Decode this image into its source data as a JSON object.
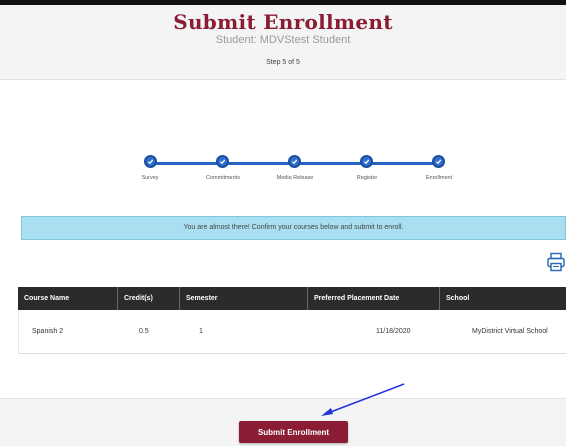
{
  "header": {
    "title": "Submit Enrollment",
    "student": "Student: MDVStest Student",
    "step": "Step 5 of 5"
  },
  "progress": {
    "steps": [
      {
        "label": "Survey",
        "complete": true
      },
      {
        "label": "Commitments",
        "complete": true
      },
      {
        "label": "Media Release",
        "complete": true
      },
      {
        "label": "Register",
        "complete": true
      },
      {
        "label": "Enrollment",
        "complete": true
      }
    ]
  },
  "info_message": "You are almost there! Confirm your courses below and submit to enroll.",
  "print_icon": "printer-icon",
  "table": {
    "columns": [
      "Course Name",
      "Credit(s)",
      "Semester",
      "Preferred Placement Date",
      "School"
    ],
    "rows": [
      [
        "Spanish 2",
        "0.5",
        "1",
        "11/18/2020",
        "MyDistrict Virtual School"
      ]
    ]
  },
  "footer": {
    "submit_label": "Submit Enrollment"
  },
  "colors": {
    "brand": "#8a1c33",
    "progress": "#2f6fd0",
    "info_bg": "#a9dff0",
    "table_header": "#2b2b2b",
    "annotation_arrow": "#2233dd"
  }
}
